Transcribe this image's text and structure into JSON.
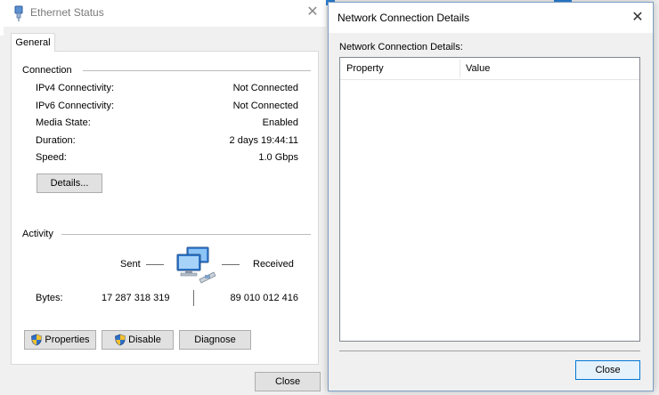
{
  "ethernet_status": {
    "title": "Ethernet Status",
    "tab_general": "General",
    "connection_group": "Connection",
    "rows": [
      {
        "label": "IPv4 Connectivity:",
        "value": "Not Connected"
      },
      {
        "label": "IPv6 Connectivity:",
        "value": "Not Connected"
      },
      {
        "label": "Media State:",
        "value": "Enabled"
      },
      {
        "label": "Duration:",
        "value": "2 days 19:44:11"
      },
      {
        "label": "Speed:",
        "value": "1.0 Gbps"
      }
    ],
    "details_button": "Details...",
    "activity_group": "Activity",
    "sent_label": "Sent",
    "received_label": "Received",
    "bytes_label": "Bytes:",
    "bytes_sent": "17 287 318 319",
    "bytes_received": "89 010 012 416",
    "properties_button": "Properties",
    "disable_button": "Disable",
    "diagnose_button": "Diagnose",
    "close_button": "Close",
    "icons": {
      "app": "ethernet-plug-icon",
      "activity": "network-computers-icon",
      "uac": "uac-shield-icon",
      "close": "close-icon"
    }
  },
  "network_connection_details": {
    "title": "Network Connection Details",
    "list_label": "Network Connection Details:",
    "columns": [
      "Property",
      "Value"
    ],
    "rows": [],
    "close_button": "Close"
  },
  "colors": {
    "accent_blue": "#0078d7",
    "button_face": "#e1e1e1",
    "window_bg": "#f0f0f0"
  }
}
